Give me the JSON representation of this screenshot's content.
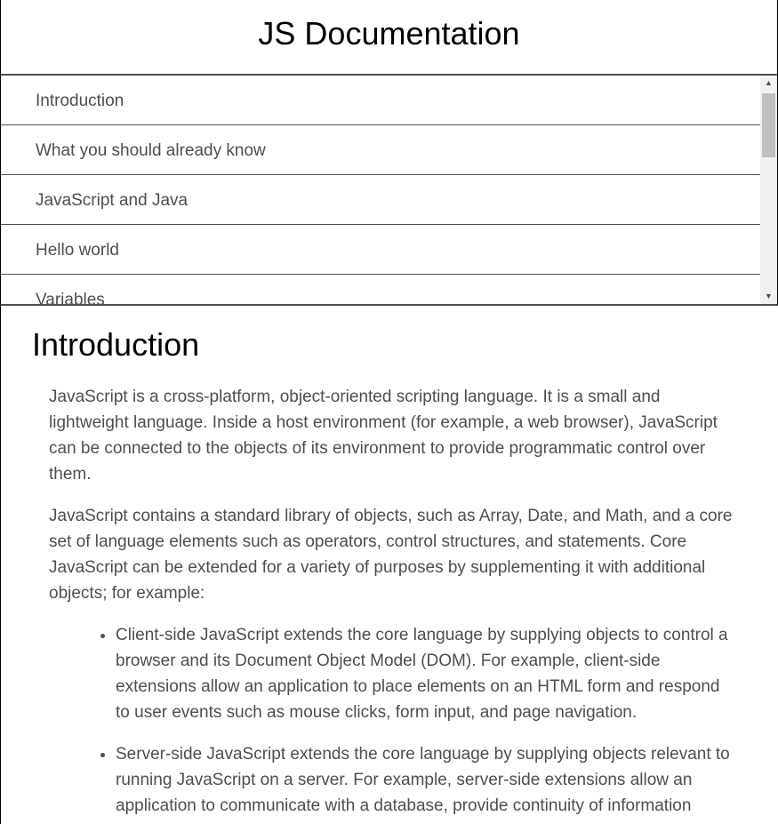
{
  "nav": {
    "title": "JS Documentation",
    "links": [
      "Introduction",
      "What you should already know",
      "JavaScript and Java",
      "Hello world",
      "Variables"
    ]
  },
  "section": {
    "title": "Introduction",
    "paragraphs": [
      "JavaScript is a cross-platform, object-oriented scripting language. It is a small and lightweight language. Inside a host environment (for example, a web browser), JavaScript can be connected to the objects of its environment to provide programmatic control over them.",
      "JavaScript contains a standard library of objects, such as Array, Date, and Math, and a core set of language elements such as operators, control structures, and statements. Core JavaScript can be extended for a variety of purposes by supplementing it with additional objects; for example:"
    ],
    "list": [
      "Client-side JavaScript extends the core language by supplying objects to control a browser and its Document Object Model (DOM). For example, client-side extensions allow an application to place elements on an HTML form and respond to user events such as mouse clicks, form input, and page navigation.",
      "Server-side JavaScript extends the core language by supplying objects relevant to running JavaScript on a server. For example, server-side extensions allow an application to communicate with a database, provide continuity of information"
    ]
  },
  "icons": {
    "scroll_up": "scroll-up-arrow-icon",
    "scroll_down": "scroll-down-arrow-icon"
  },
  "colors": {
    "text": "#4d4e53",
    "heading": "#000000",
    "scrollbar_track": "#f1f1f1",
    "scrollbar_thumb": "#c1c1c1"
  }
}
